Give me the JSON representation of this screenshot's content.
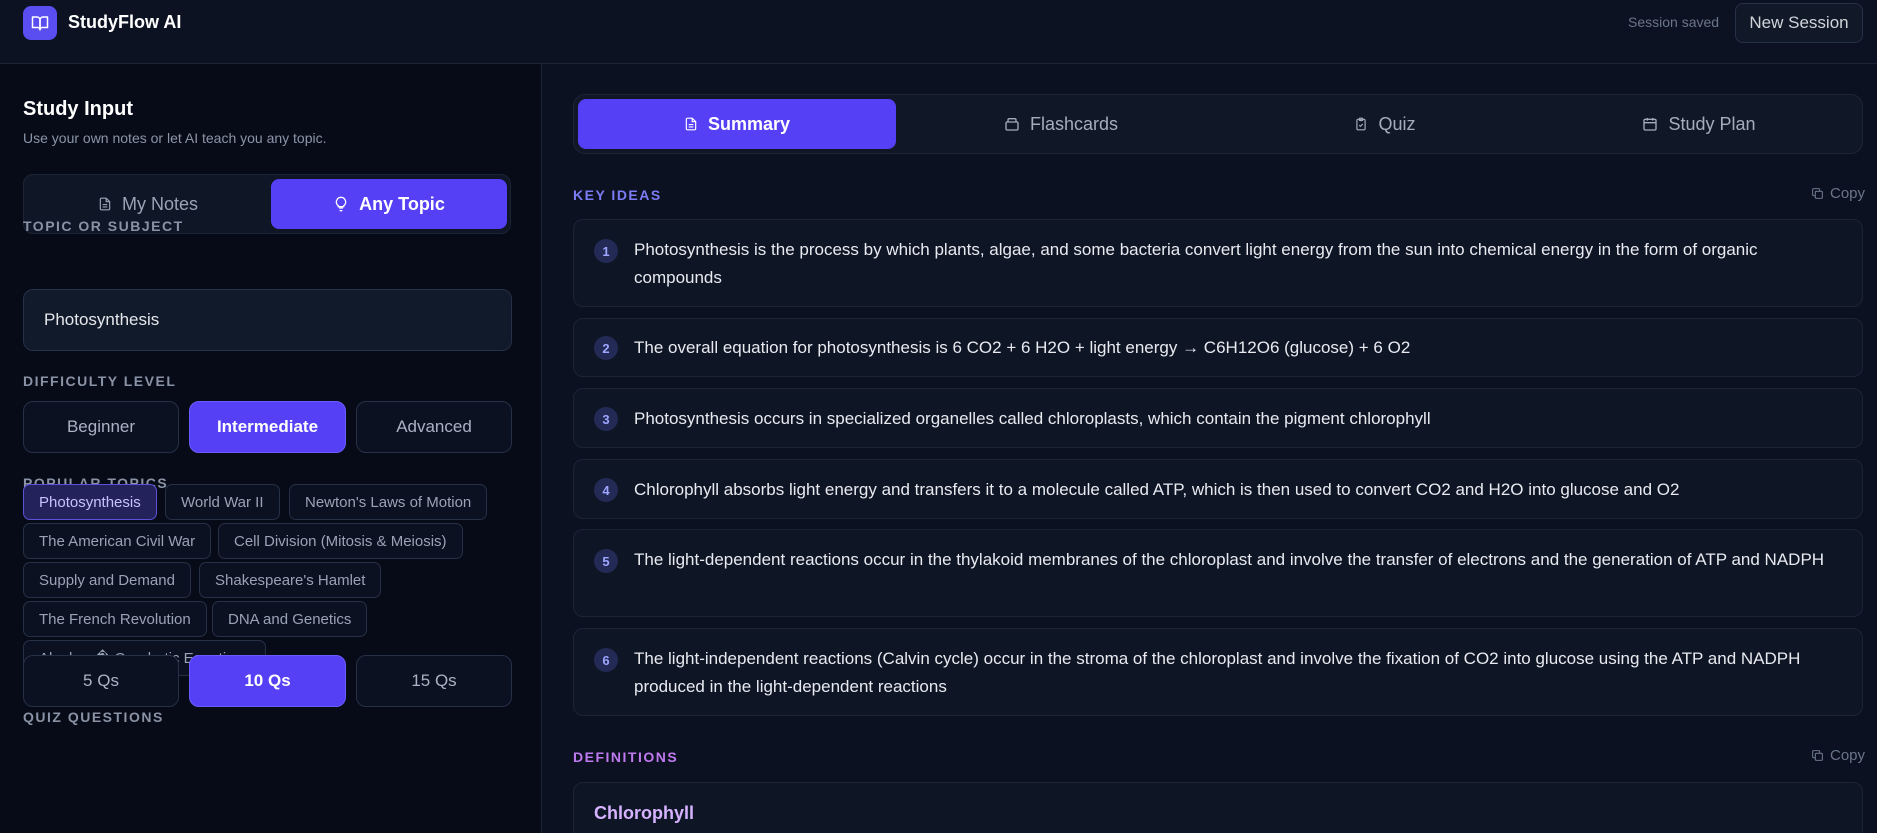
{
  "header": {
    "app_title": "StudyFlow AI",
    "logo_icon": "book-icon",
    "status": "Session saved",
    "new_session_label": "New Session"
  },
  "left_panel": {
    "title": "Study Input",
    "subtitle": "Use your own notes or let AI teach you any topic.",
    "mode_tabs": [
      {
        "label": "My Notes",
        "icon": "document-icon",
        "active": false
      },
      {
        "label": "Any Topic",
        "icon": "lightbulb-icon",
        "active": true
      }
    ],
    "topic_label": "TOPIC OR SUBJECT",
    "topic_value": "Photosynthesis",
    "difficulty_label": "DIFFICULTY LEVEL",
    "difficulty_options": [
      {
        "label": "Beginner",
        "active": false
      },
      {
        "label": "Intermediate",
        "active": true
      },
      {
        "label": "Advanced",
        "active": false
      }
    ],
    "popular_label": "POPULAR TOPICS",
    "popular_topics": [
      {
        "label": "Photosynthesis",
        "active": true
      },
      {
        "label": "World War II",
        "active": false
      },
      {
        "label": "Newton's Laws of Motion",
        "active": false
      },
      {
        "label": "The American Civil War",
        "active": false
      },
      {
        "label": "Cell Division (Mitosis & Meiosis)",
        "active": false
      },
      {
        "label": "Supply and Demand",
        "active": false
      },
      {
        "label": "Shakespeare's Hamlet",
        "active": false
      },
      {
        "label": "The French Revolution",
        "active": false
      },
      {
        "label": "DNA and Genetics",
        "active": false
      },
      {
        "label": "Algebra � Quadratic Equations",
        "active": false
      }
    ],
    "quiz_label": "QUIZ QUESTIONS",
    "quiz_options": [
      {
        "label": "5 Qs",
        "active": false
      },
      {
        "label": "10 Qs",
        "active": true
      },
      {
        "label": "15 Qs",
        "active": false
      }
    ]
  },
  "main": {
    "tabs": [
      {
        "label": "Summary",
        "icon": "document-icon",
        "active": true
      },
      {
        "label": "Flashcards",
        "icon": "cards-icon",
        "active": false
      },
      {
        "label": "Quiz",
        "icon": "clipboard-check-icon",
        "active": false
      },
      {
        "label": "Study Plan",
        "icon": "calendar-icon",
        "active": false
      }
    ],
    "key_ideas_label": "KEY IDEAS",
    "copy_label": "Copy",
    "key_ideas": [
      {
        "num": "1",
        "text": "Photosynthesis is the process by which plants, algae, and some bacteria convert light energy from the sun into chemical energy in the form of organic compounds"
      },
      {
        "num": "2",
        "text": "The overall equation for photosynthesis is 6 CO2 + 6 H2O + light energy → C6H12O6 (glucose) + 6 O2"
      },
      {
        "num": "3",
        "text": "Photosynthesis occurs in specialized organelles called chloroplasts, which contain the pigment chlorophyll"
      },
      {
        "num": "4",
        "text": "Chlorophyll absorbs light energy and transfers it to a molecule called ATP, which is then used to convert CO2 and H2O into glucose and O2"
      },
      {
        "num": "5",
        "text": "The light-dependent reactions occur in the thylakoid membranes of the chloroplast and involve the transfer of electrons and the generation of ATP and NADPH"
      },
      {
        "num": "6",
        "text": "The light-independent reactions (Calvin cycle) occur in the stroma of the chloroplast and involve the fixation of CO2 into glucose using the ATP and NADPH produced in the light-dependent reactions"
      }
    ],
    "definitions_label": "DEFINITIONS",
    "definitions": [
      {
        "term": "Chlorophyll"
      }
    ]
  },
  "colors": {
    "accent": "#5540f5",
    "key_ideas_label": "#7c7cf5",
    "definitions_label": "#c07af0",
    "background": "#0b1120"
  }
}
